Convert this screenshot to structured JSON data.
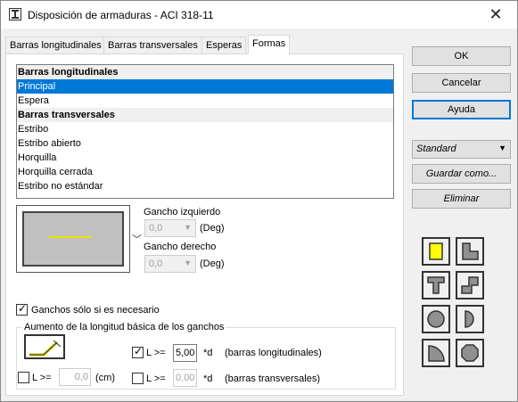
{
  "window": {
    "title": "Disposición de armaduras - ACI 318-11",
    "close_glyph": "✕"
  },
  "tabs": [
    {
      "label": "Barras longitudinales"
    },
    {
      "label": "Barras transversales"
    },
    {
      "label": "Esperas"
    },
    {
      "label": "Formas",
      "active": true
    }
  ],
  "shape_list": [
    {
      "label": "Barras longitudinales",
      "type": "header"
    },
    {
      "label": "Principal",
      "type": "selected"
    },
    {
      "label": "Espera",
      "type": "item"
    },
    {
      "label": "Barras transversales",
      "type": "header"
    },
    {
      "label": "Estribo",
      "type": "item"
    },
    {
      "label": "Estribo abierto",
      "type": "item"
    },
    {
      "label": "Horquilla",
      "type": "item"
    },
    {
      "label": "Horquilla cerrada",
      "type": "item"
    },
    {
      "label": "Estribo no estándar",
      "type": "item"
    }
  ],
  "hooks": {
    "left_label": "Gancho izquierdo",
    "left_value": "0,0",
    "left_unit": "(Deg)",
    "right_label": "Gancho derecho",
    "right_value": "0,0",
    "right_unit": "(Deg)"
  },
  "hooks_only_if_needed": {
    "label": "Ganchos sólo si es necesario",
    "checked": true
  },
  "length_group": {
    "title": "Aumento de la longitud básica de los ganchos",
    "cm_check_label": "L >=",
    "cm_value": "0,0",
    "cm_unit": "(cm)",
    "long_check_label": "L >=",
    "long_value": "5,00",
    "long_unit": "*d",
    "long_desc": "(barras longitudinales)",
    "trans_check_label": "L >=",
    "trans_value": "0,00",
    "trans_unit": "*d",
    "trans_desc": "(barras transversales)"
  },
  "side_buttons": {
    "ok": "OK",
    "cancel": "Cancelar",
    "help": "Ayuda",
    "preset": "Standard",
    "save_as": "Guardar como...",
    "delete": "Eliminar"
  },
  "colors": {
    "selection": "#0078d7",
    "hook_preview_bar": "#e8e000",
    "shape_square_fill": "#ffff00"
  },
  "section_shapes": [
    "square-section-icon",
    "l-section-icon",
    "t-section-icon",
    "z-section-icon",
    "circle-section-icon",
    "half-circle-section-icon",
    "quarter-circle-section-icon",
    "octagon-section-icon"
  ]
}
